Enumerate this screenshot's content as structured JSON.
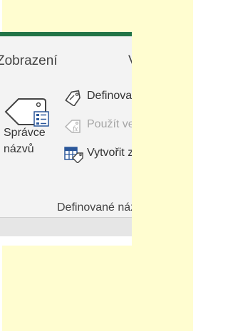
{
  "tabs": {
    "view": "Zobrazení",
    "partial_next": "V"
  },
  "ribbon": {
    "name_manager": {
      "line1": "Správce",
      "line2": "názvů"
    },
    "commands": [
      {
        "label": "Definovat název",
        "enabled": true,
        "icon": "tag-icon"
      },
      {
        "label": "Použít ve vzorci",
        "enabled": false,
        "icon": "fx-tag-icon"
      },
      {
        "label": "Vytvořit z výběru",
        "enabled": true,
        "icon": "create-from-selection-icon"
      }
    ],
    "group_label": "Definované názvy"
  },
  "colors": {
    "excel_green": "#217346",
    "ribbon_bg": "#f3f3f3",
    "page_bg": "#fffdd0"
  }
}
